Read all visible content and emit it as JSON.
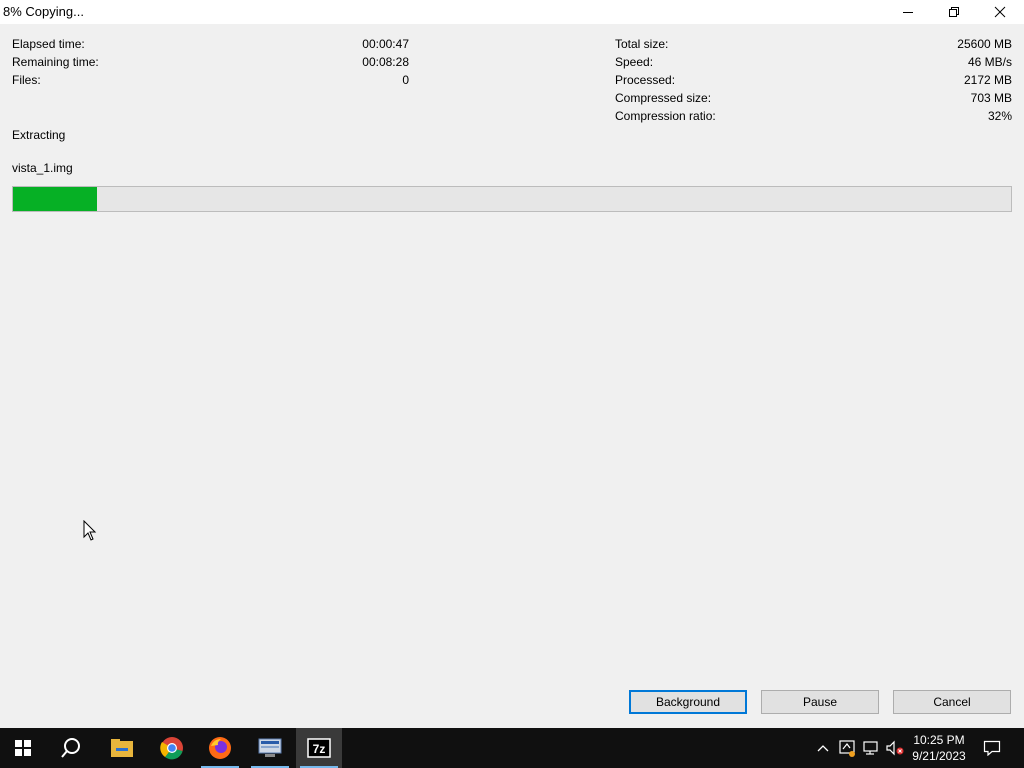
{
  "window": {
    "title": "8% Copying..."
  },
  "stats_left": [
    {
      "label": "Elapsed time:",
      "value": "00:00:47"
    },
    {
      "label": "Remaining time:",
      "value": "00:08:28"
    },
    {
      "label": "Files:",
      "value": "0"
    }
  ],
  "stats_right": [
    {
      "label": "Total size:",
      "value": "25600 MB"
    },
    {
      "label": "Speed:",
      "value": "46 MB/s"
    },
    {
      "label": "Processed:",
      "value": "2172 MB"
    },
    {
      "label": "Compressed size:",
      "value": "703 MB"
    },
    {
      "label": "Compression ratio:",
      "value": "32%"
    }
  ],
  "operation": "Extracting",
  "current_file": "vista_1.img",
  "progress": {
    "percent": 8,
    "color": "#06b025"
  },
  "buttons": {
    "background": "Background",
    "pause": "Pause",
    "cancel": "Cancel"
  },
  "taskbar": {
    "apps": [
      "start-icon",
      "search-icon",
      "file-explorer-icon",
      "chrome-icon",
      "firefox-icon",
      "network-app-icon",
      "7zip-icon"
    ],
    "active_app": "7zip-icon",
    "clock_time": "10:25 PM",
    "clock_date": "9/21/2023"
  }
}
